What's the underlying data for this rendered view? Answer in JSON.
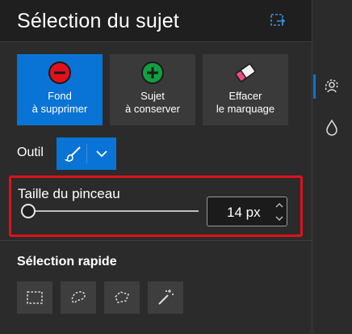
{
  "panel": {
    "title": "Sélection du sujet"
  },
  "mark_buttons": [
    {
      "line1": "Fond",
      "line2": "à supprimer",
      "icon": "minus-circle-icon",
      "color": "#e0111b",
      "active": true
    },
    {
      "line1": "Sujet",
      "line2": "à conserver",
      "icon": "plus-circle-icon",
      "color": "#10a040",
      "active": false
    },
    {
      "line1": "Effacer",
      "line2": "le marquage",
      "icon": "eraser-icon",
      "active": false
    }
  ],
  "tool": {
    "label": "Outil",
    "selected": "brush-icon"
  },
  "brush_size": {
    "label": "Taille du pinceau",
    "value": "14 px",
    "slider_fraction": 0.0
  },
  "quick_selection": {
    "title": "Sélection rapide",
    "tools": [
      "rectangle-select-icon",
      "lasso-select-icon",
      "polygon-lasso-icon",
      "magic-wand-icon"
    ]
  },
  "side_rail": {
    "items": [
      "subject-select-icon",
      "drop-icon"
    ]
  },
  "colors": {
    "accent": "#0a74d6",
    "highlight": "#e0111b",
    "background": "#2b2b2b"
  }
}
